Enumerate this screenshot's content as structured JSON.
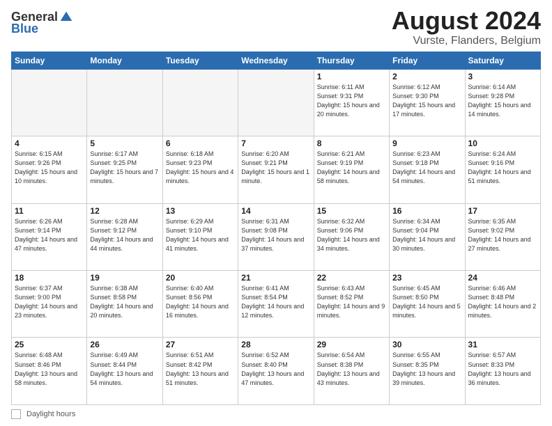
{
  "logo": {
    "general": "General",
    "blue": "Blue"
  },
  "title": "August 2024",
  "subtitle": "Vurste, Flanders, Belgium",
  "days_of_week": [
    "Sunday",
    "Monday",
    "Tuesday",
    "Wednesday",
    "Thursday",
    "Friday",
    "Saturday"
  ],
  "footer": {
    "label": "Daylight hours"
  },
  "weeks": [
    [
      {
        "day": "",
        "info": "",
        "empty": true
      },
      {
        "day": "",
        "info": "",
        "empty": true
      },
      {
        "day": "",
        "info": "",
        "empty": true
      },
      {
        "day": "",
        "info": "",
        "empty": true
      },
      {
        "day": "1",
        "info": "Sunrise: 6:11 AM\nSunset: 9:31 PM\nDaylight: 15 hours\nand 20 minutes."
      },
      {
        "day": "2",
        "info": "Sunrise: 6:12 AM\nSunset: 9:30 PM\nDaylight: 15 hours\nand 17 minutes."
      },
      {
        "day": "3",
        "info": "Sunrise: 6:14 AM\nSunset: 9:28 PM\nDaylight: 15 hours\nand 14 minutes."
      }
    ],
    [
      {
        "day": "4",
        "info": "Sunrise: 6:15 AM\nSunset: 9:26 PM\nDaylight: 15 hours\nand 10 minutes."
      },
      {
        "day": "5",
        "info": "Sunrise: 6:17 AM\nSunset: 9:25 PM\nDaylight: 15 hours\nand 7 minutes."
      },
      {
        "day": "6",
        "info": "Sunrise: 6:18 AM\nSunset: 9:23 PM\nDaylight: 15 hours\nand 4 minutes."
      },
      {
        "day": "7",
        "info": "Sunrise: 6:20 AM\nSunset: 9:21 PM\nDaylight: 15 hours\nand 1 minute."
      },
      {
        "day": "8",
        "info": "Sunrise: 6:21 AM\nSunset: 9:19 PM\nDaylight: 14 hours\nand 58 minutes."
      },
      {
        "day": "9",
        "info": "Sunrise: 6:23 AM\nSunset: 9:18 PM\nDaylight: 14 hours\nand 54 minutes."
      },
      {
        "day": "10",
        "info": "Sunrise: 6:24 AM\nSunset: 9:16 PM\nDaylight: 14 hours\nand 51 minutes."
      }
    ],
    [
      {
        "day": "11",
        "info": "Sunrise: 6:26 AM\nSunset: 9:14 PM\nDaylight: 14 hours\nand 47 minutes."
      },
      {
        "day": "12",
        "info": "Sunrise: 6:28 AM\nSunset: 9:12 PM\nDaylight: 14 hours\nand 44 minutes."
      },
      {
        "day": "13",
        "info": "Sunrise: 6:29 AM\nSunset: 9:10 PM\nDaylight: 14 hours\nand 41 minutes."
      },
      {
        "day": "14",
        "info": "Sunrise: 6:31 AM\nSunset: 9:08 PM\nDaylight: 14 hours\nand 37 minutes."
      },
      {
        "day": "15",
        "info": "Sunrise: 6:32 AM\nSunset: 9:06 PM\nDaylight: 14 hours\nand 34 minutes."
      },
      {
        "day": "16",
        "info": "Sunrise: 6:34 AM\nSunset: 9:04 PM\nDaylight: 14 hours\nand 30 minutes."
      },
      {
        "day": "17",
        "info": "Sunrise: 6:35 AM\nSunset: 9:02 PM\nDaylight: 14 hours\nand 27 minutes."
      }
    ],
    [
      {
        "day": "18",
        "info": "Sunrise: 6:37 AM\nSunset: 9:00 PM\nDaylight: 14 hours\nand 23 minutes."
      },
      {
        "day": "19",
        "info": "Sunrise: 6:38 AM\nSunset: 8:58 PM\nDaylight: 14 hours\nand 20 minutes."
      },
      {
        "day": "20",
        "info": "Sunrise: 6:40 AM\nSunset: 8:56 PM\nDaylight: 14 hours\nand 16 minutes."
      },
      {
        "day": "21",
        "info": "Sunrise: 6:41 AM\nSunset: 8:54 PM\nDaylight: 14 hours\nand 12 minutes."
      },
      {
        "day": "22",
        "info": "Sunrise: 6:43 AM\nSunset: 8:52 PM\nDaylight: 14 hours\nand 9 minutes."
      },
      {
        "day": "23",
        "info": "Sunrise: 6:45 AM\nSunset: 8:50 PM\nDaylight: 14 hours\nand 5 minutes."
      },
      {
        "day": "24",
        "info": "Sunrise: 6:46 AM\nSunset: 8:48 PM\nDaylight: 14 hours\nand 2 minutes."
      }
    ],
    [
      {
        "day": "25",
        "info": "Sunrise: 6:48 AM\nSunset: 8:46 PM\nDaylight: 13 hours\nand 58 minutes."
      },
      {
        "day": "26",
        "info": "Sunrise: 6:49 AM\nSunset: 8:44 PM\nDaylight: 13 hours\nand 54 minutes."
      },
      {
        "day": "27",
        "info": "Sunrise: 6:51 AM\nSunset: 8:42 PM\nDaylight: 13 hours\nand 51 minutes."
      },
      {
        "day": "28",
        "info": "Sunrise: 6:52 AM\nSunset: 8:40 PM\nDaylight: 13 hours\nand 47 minutes."
      },
      {
        "day": "29",
        "info": "Sunrise: 6:54 AM\nSunset: 8:38 PM\nDaylight: 13 hours\nand 43 minutes."
      },
      {
        "day": "30",
        "info": "Sunrise: 6:55 AM\nSunset: 8:35 PM\nDaylight: 13 hours\nand 39 minutes."
      },
      {
        "day": "31",
        "info": "Sunrise: 6:57 AM\nSunset: 8:33 PM\nDaylight: 13 hours\nand 36 minutes."
      }
    ]
  ]
}
